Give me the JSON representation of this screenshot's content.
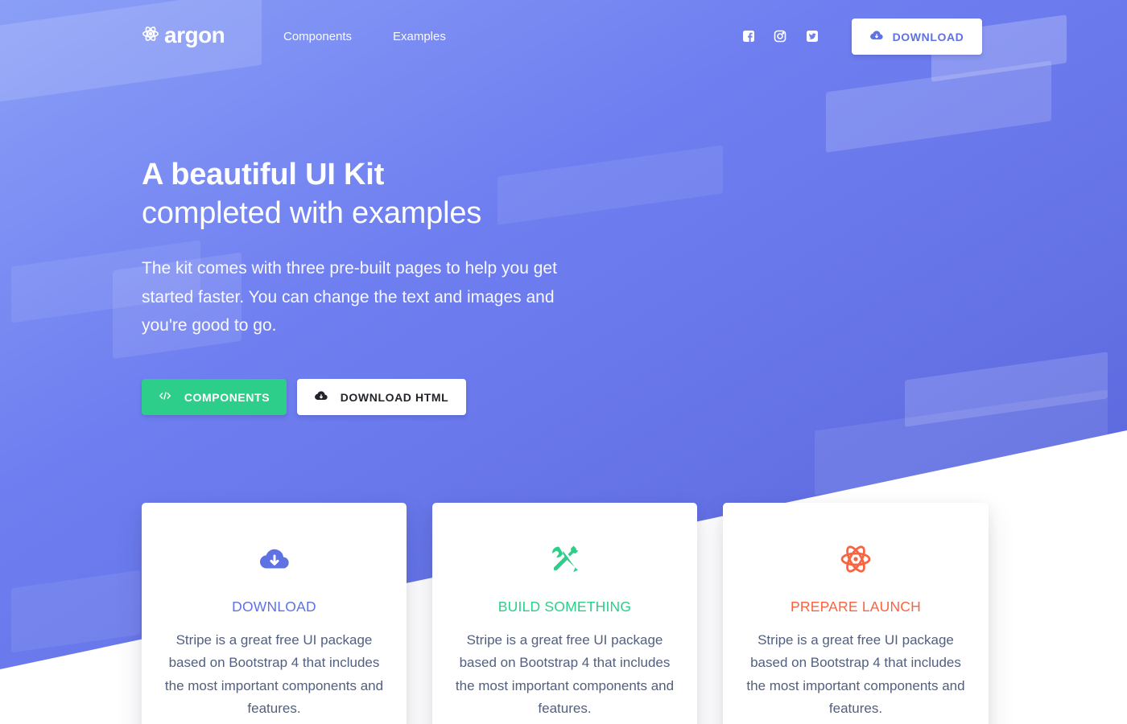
{
  "nav": {
    "brand": "argon",
    "links": [
      "Components",
      "Examples"
    ],
    "social": [
      "facebook-square-icon",
      "instagram-icon",
      "twitter-square-icon"
    ],
    "download_label": "DOWNLOAD"
  },
  "hero": {
    "title": "A beautiful UI Kit",
    "subtitle": "completed with examples",
    "text": "The kit comes with three pre-built pages to help you get started faster. You can change the text and images and you're good to go.",
    "buttons": [
      {
        "label": "COMPONENTS",
        "icon": "code-icon"
      },
      {
        "label": "DOWNLOAD HTML",
        "icon": "cloud-download-icon"
      }
    ]
  },
  "cards": [
    {
      "title": "DOWNLOAD",
      "icon": "cloud-download-icon",
      "color": "#5e72e4",
      "text": "Stripe is a great free UI package based on Bootstrap 4 that includes the most important components and features."
    },
    {
      "title": "BUILD SOMETHING",
      "icon": "tools-icon",
      "color": "#2dce89",
      "text": "Stripe is a great free UI package based on Bootstrap 4 that includes the most important components and features."
    },
    {
      "title": "PREPARE LAUNCH",
      "icon": "atom-icon",
      "color": "#fb6340",
      "text": "Stripe is a great free UI package based on Bootstrap 4 that includes the most important components and features."
    }
  ],
  "colors": {
    "primary": "#5e72e4",
    "success": "#2dce89",
    "warning": "#fb6340",
    "text_muted": "#525f7f"
  }
}
